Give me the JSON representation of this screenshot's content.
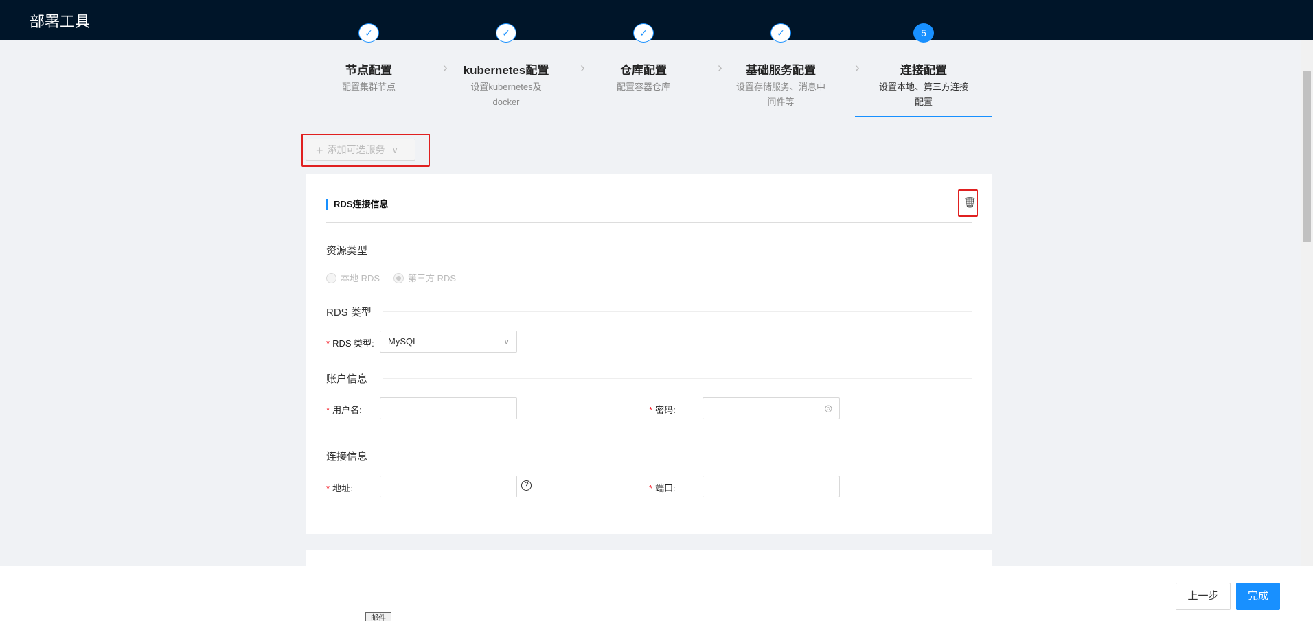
{
  "app": {
    "title": "部署工具"
  },
  "steps": [
    {
      "icon": "✓",
      "title": "节点配置",
      "desc": "配置集群节点"
    },
    {
      "icon": "✓",
      "title": "kubernetes配置",
      "desc": "设置kubernetes及docker"
    },
    {
      "icon": "✓",
      "title": "仓库配置",
      "desc": "配置容器仓库"
    },
    {
      "icon": "✓",
      "title": "基础服务配置",
      "desc": "设置存储服务、消息中间件等"
    },
    {
      "icon": "5",
      "title": "连接配置",
      "desc": "设置本地、第三方连接配置"
    }
  ],
  "add_service": {
    "label": "添加可选服务",
    "plus": "+",
    "caret": "∨"
  },
  "card": {
    "title": "RDS连接信息",
    "delete_icon": "🗑",
    "sections": {
      "resource_type": "资源类型",
      "rds_type": "RDS 类型",
      "account": "账户信息",
      "connection": "连接信息"
    },
    "radios": [
      {
        "label": "本地 RDS",
        "checked": false
      },
      {
        "label": "第三方 RDS",
        "checked": true
      }
    ],
    "fields": {
      "rds_type_label": "RDS 类型:",
      "rds_type_value": "MySQL",
      "username_label": "用户名:",
      "password_label": "密码:",
      "address_label": "地址:",
      "port_label": "端口:",
      "required_mark": "*",
      "help_glyph": "?",
      "eye_glyph": "◎"
    }
  },
  "footer": {
    "prev_label": "上一步",
    "done_label": "完成"
  },
  "bottom_tag": "邮件",
  "colors": {
    "accent": "#1890ff",
    "header": "#001529",
    "highlight": "#e02020"
  }
}
